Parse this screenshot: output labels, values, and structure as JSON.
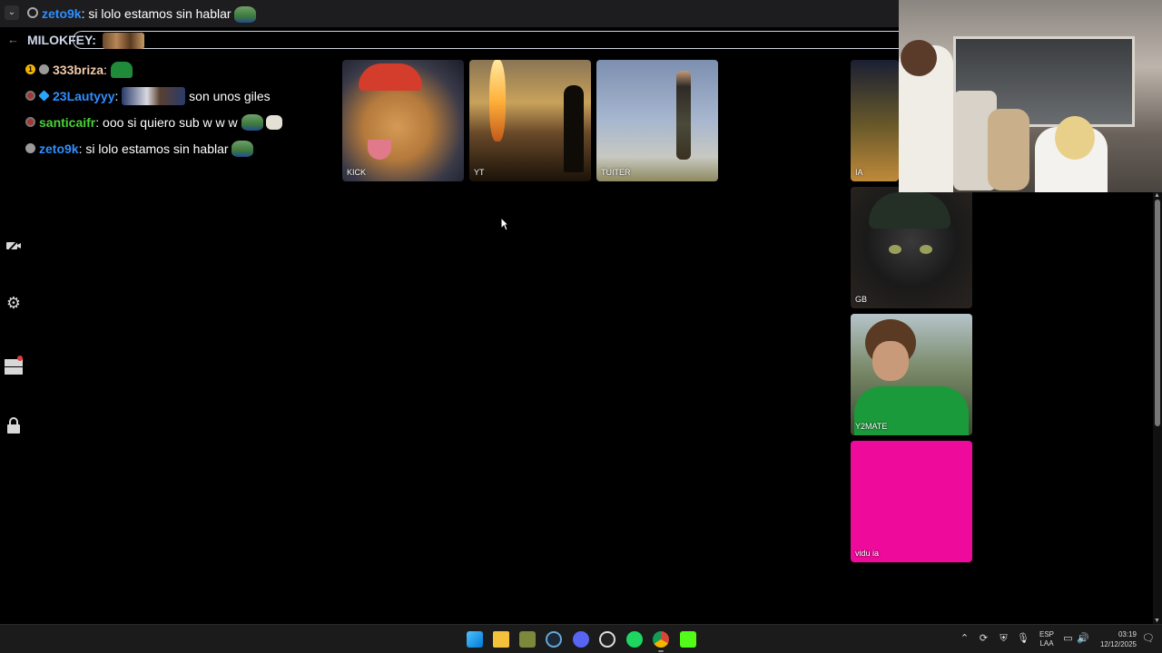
{
  "top_bar": {
    "collapse_icon": "chevron-down-icon",
    "search_icon": "search-icon",
    "reply_user": "zeto9k",
    "reply_text": ": si lolo estamos sin hablar"
  },
  "pinned": {
    "user": "MILOKFEY:",
    "back_icon": "arrow-left-icon"
  },
  "chat": {
    "messages": [
      {
        "user": "333briza",
        "text": "",
        "user_color": "#f1c9a8"
      },
      {
        "user": "23Lautyyy",
        "text": "son unos giles",
        "user_color": "#2f8fff"
      },
      {
        "user": "santicaifr",
        "text": ": ooo si quiero sub w w w",
        "user_color": "#4cd137"
      },
      {
        "user": "zeto9k",
        "text": ": si lolo estamos sin hablar",
        "user_color": "#2f8fff"
      }
    ]
  },
  "sidebar": {
    "icons": [
      "video-off-icon",
      "gear-icon",
      "layout-icon",
      "lock-icon"
    ]
  },
  "tiles": [
    {
      "label": "KICK"
    },
    {
      "label": "YT"
    },
    {
      "label": "TUITER"
    },
    {
      "label": "IA"
    },
    {
      "label": "GB"
    },
    {
      "label": "Y2MATE"
    },
    {
      "label": "vidu ia"
    }
  ],
  "taskbar": {
    "apps": [
      "windows-start-icon",
      "file-explorer-icon",
      "game-icon",
      "steam-icon",
      "discord-icon",
      "obs-icon",
      "spotify-icon",
      "chrome-icon",
      "kick-icon"
    ],
    "language_top": "ESP",
    "language_bottom": "LAA",
    "time": "03:19",
    "date": "12/12/2025"
  },
  "colors": {
    "vidu_tile": "#ee0a9a",
    "username_blue": "#2f8fff",
    "username_green": "#4cd137"
  }
}
